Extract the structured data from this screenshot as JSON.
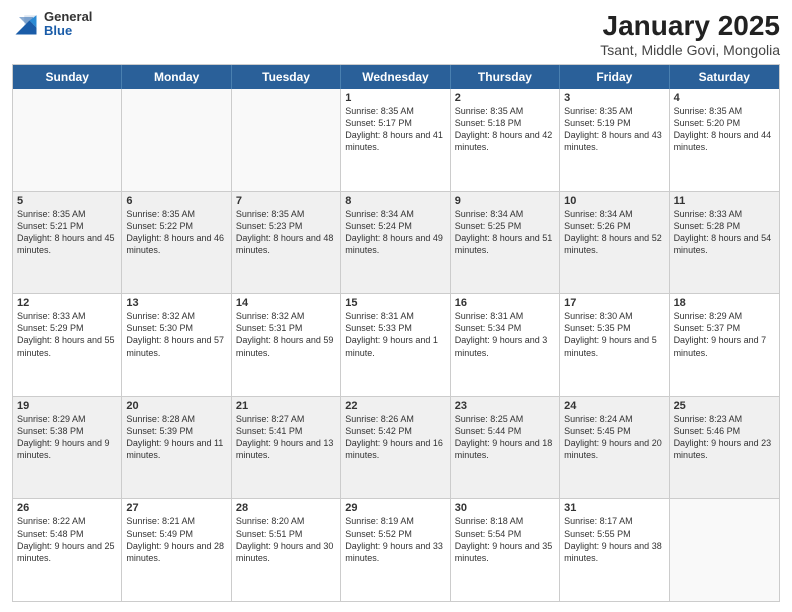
{
  "header": {
    "logo": {
      "general": "General",
      "blue": "Blue"
    },
    "title": "January 2025",
    "subtitle": "Tsant, Middle Govi, Mongolia"
  },
  "dayHeaders": [
    "Sunday",
    "Monday",
    "Tuesday",
    "Wednesday",
    "Thursday",
    "Friday",
    "Saturday"
  ],
  "weeks": [
    [
      {
        "num": "",
        "info": "",
        "empty": true
      },
      {
        "num": "",
        "info": "",
        "empty": true
      },
      {
        "num": "",
        "info": "",
        "empty": true
      },
      {
        "num": "1",
        "info": "Sunrise: 8:35 AM\nSunset: 5:17 PM\nDaylight: 8 hours\nand 41 minutes."
      },
      {
        "num": "2",
        "info": "Sunrise: 8:35 AM\nSunset: 5:18 PM\nDaylight: 8 hours\nand 42 minutes."
      },
      {
        "num": "3",
        "info": "Sunrise: 8:35 AM\nSunset: 5:19 PM\nDaylight: 8 hours\nand 43 minutes."
      },
      {
        "num": "4",
        "info": "Sunrise: 8:35 AM\nSunset: 5:20 PM\nDaylight: 8 hours\nand 44 minutes."
      }
    ],
    [
      {
        "num": "5",
        "info": "Sunrise: 8:35 AM\nSunset: 5:21 PM\nDaylight: 8 hours\nand 45 minutes."
      },
      {
        "num": "6",
        "info": "Sunrise: 8:35 AM\nSunset: 5:22 PM\nDaylight: 8 hours\nand 46 minutes."
      },
      {
        "num": "7",
        "info": "Sunrise: 8:35 AM\nSunset: 5:23 PM\nDaylight: 8 hours\nand 48 minutes."
      },
      {
        "num": "8",
        "info": "Sunrise: 8:34 AM\nSunset: 5:24 PM\nDaylight: 8 hours\nand 49 minutes."
      },
      {
        "num": "9",
        "info": "Sunrise: 8:34 AM\nSunset: 5:25 PM\nDaylight: 8 hours\nand 51 minutes."
      },
      {
        "num": "10",
        "info": "Sunrise: 8:34 AM\nSunset: 5:26 PM\nDaylight: 8 hours\nand 52 minutes."
      },
      {
        "num": "11",
        "info": "Sunrise: 8:33 AM\nSunset: 5:28 PM\nDaylight: 8 hours\nand 54 minutes."
      }
    ],
    [
      {
        "num": "12",
        "info": "Sunrise: 8:33 AM\nSunset: 5:29 PM\nDaylight: 8 hours\nand 55 minutes."
      },
      {
        "num": "13",
        "info": "Sunrise: 8:32 AM\nSunset: 5:30 PM\nDaylight: 8 hours\nand 57 minutes."
      },
      {
        "num": "14",
        "info": "Sunrise: 8:32 AM\nSunset: 5:31 PM\nDaylight: 8 hours\nand 59 minutes."
      },
      {
        "num": "15",
        "info": "Sunrise: 8:31 AM\nSunset: 5:33 PM\nDaylight: 9 hours\nand 1 minute."
      },
      {
        "num": "16",
        "info": "Sunrise: 8:31 AM\nSunset: 5:34 PM\nDaylight: 9 hours\nand 3 minutes."
      },
      {
        "num": "17",
        "info": "Sunrise: 8:30 AM\nSunset: 5:35 PM\nDaylight: 9 hours\nand 5 minutes."
      },
      {
        "num": "18",
        "info": "Sunrise: 8:29 AM\nSunset: 5:37 PM\nDaylight: 9 hours\nand 7 minutes."
      }
    ],
    [
      {
        "num": "19",
        "info": "Sunrise: 8:29 AM\nSunset: 5:38 PM\nDaylight: 9 hours\nand 9 minutes."
      },
      {
        "num": "20",
        "info": "Sunrise: 8:28 AM\nSunset: 5:39 PM\nDaylight: 9 hours\nand 11 minutes."
      },
      {
        "num": "21",
        "info": "Sunrise: 8:27 AM\nSunset: 5:41 PM\nDaylight: 9 hours\nand 13 minutes."
      },
      {
        "num": "22",
        "info": "Sunrise: 8:26 AM\nSunset: 5:42 PM\nDaylight: 9 hours\nand 16 minutes."
      },
      {
        "num": "23",
        "info": "Sunrise: 8:25 AM\nSunset: 5:44 PM\nDaylight: 9 hours\nand 18 minutes."
      },
      {
        "num": "24",
        "info": "Sunrise: 8:24 AM\nSunset: 5:45 PM\nDaylight: 9 hours\nand 20 minutes."
      },
      {
        "num": "25",
        "info": "Sunrise: 8:23 AM\nSunset: 5:46 PM\nDaylight: 9 hours\nand 23 minutes."
      }
    ],
    [
      {
        "num": "26",
        "info": "Sunrise: 8:22 AM\nSunset: 5:48 PM\nDaylight: 9 hours\nand 25 minutes."
      },
      {
        "num": "27",
        "info": "Sunrise: 8:21 AM\nSunset: 5:49 PM\nDaylight: 9 hours\nand 28 minutes."
      },
      {
        "num": "28",
        "info": "Sunrise: 8:20 AM\nSunset: 5:51 PM\nDaylight: 9 hours\nand 30 minutes."
      },
      {
        "num": "29",
        "info": "Sunrise: 8:19 AM\nSunset: 5:52 PM\nDaylight: 9 hours\nand 33 minutes."
      },
      {
        "num": "30",
        "info": "Sunrise: 8:18 AM\nSunset: 5:54 PM\nDaylight: 9 hours\nand 35 minutes."
      },
      {
        "num": "31",
        "info": "Sunrise: 8:17 AM\nSunset: 5:55 PM\nDaylight: 9 hours\nand 38 minutes."
      },
      {
        "num": "",
        "info": "",
        "empty": true
      }
    ]
  ]
}
